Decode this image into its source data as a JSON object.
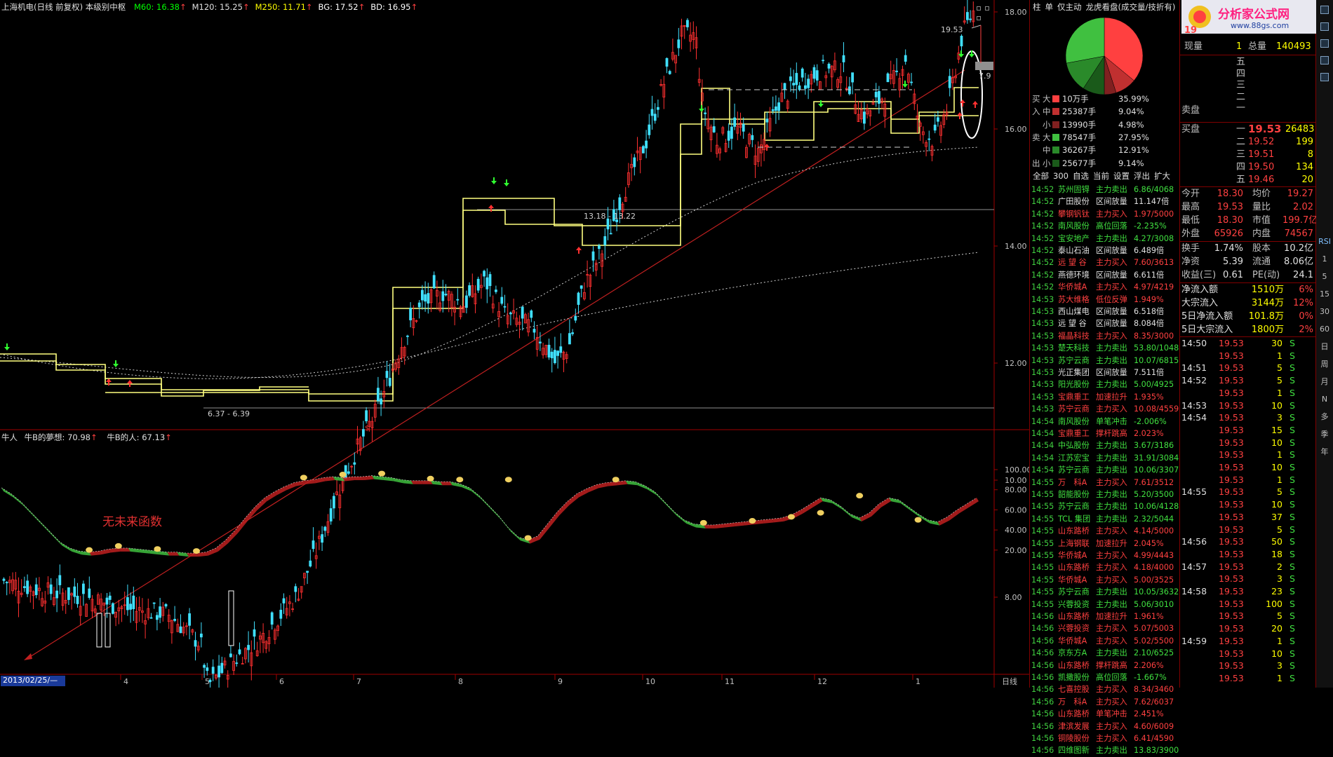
{
  "header": {
    "stock_title": "上海机电(日线 前复权) 本级别中枢",
    "ma_legend": [
      {
        "label": "M60: 16.38",
        "color": "#00ff00"
      },
      {
        "label": "M120: 15.25",
        "color": "#e0e0e0"
      },
      {
        "label": "M250: 11.71",
        "color": "#ffff00"
      },
      {
        "label": "BG: 17.52",
        "color": "#ffffff"
      },
      {
        "label": "BD: 16.95",
        "color": "#ffffff"
      }
    ]
  },
  "main_chart": {
    "y_ticks": [
      "18.00",
      "16.00",
      "14.00",
      "12.00",
      "10.00",
      "8.00"
    ],
    "y_values": [
      18,
      16,
      14,
      12,
      10,
      8
    ],
    "annotations": {
      "high_label": "19.53",
      "range_label": "13.18 - 13.22",
      "low_label": "6.37 - 6.39",
      "right_label": "7.9"
    }
  },
  "indicator": {
    "legend_left": "牛人",
    "legend_a": "牛B的夢想: 70.98",
    "legend_b": "牛B的人: 67.13",
    "note": "无未来函数",
    "y_ticks": [
      "100.00",
      "80.00",
      "60.00",
      "40.00",
      "20.00"
    ],
    "y_values": [
      100,
      80,
      60,
      40,
      20
    ],
    "series_sample": [
      82,
      76,
      68,
      58,
      48,
      38,
      28,
      22,
      19,
      18,
      19,
      21,
      22,
      22,
      21,
      20,
      19,
      18,
      18,
      17,
      17,
      18,
      22,
      30,
      40,
      52,
      63,
      72,
      78,
      83,
      87,
      89,
      90,
      92,
      93,
      92,
      93,
      93,
      94,
      93,
      92,
      90,
      89,
      89,
      89,
      88,
      88,
      86,
      82,
      74,
      64,
      54,
      42,
      33,
      30,
      34,
      46,
      58,
      68,
      76,
      81,
      85,
      87,
      88,
      89,
      88,
      84,
      78,
      68,
      58,
      50,
      46,
      45,
      45,
      46,
      47,
      48,
      49,
      50,
      51,
      52,
      55,
      60,
      66,
      72,
      70,
      64,
      56,
      52,
      57,
      66,
      72,
      70,
      63,
      56,
      50,
      48,
      53,
      60,
      66,
      72
    ]
  },
  "x_axis": {
    "start_date": "2013/02/25/—",
    "labels": [
      "4",
      "5",
      "6",
      "7",
      "8",
      "9",
      "10",
      "11",
      "12",
      "1"
    ],
    "period": "日线"
  },
  "ticker": {
    "tabs": [
      "柱",
      "单",
      "仅主动",
      "龙虎看盘(成交量/技折有)"
    ],
    "pie": [
      {
        "name": "big_sell",
        "value": 35.99,
        "color": "#ff4040"
      },
      {
        "name": "mid_sell",
        "value": 9.04,
        "color": "#c03030"
      },
      {
        "name": "small_sell",
        "value": 4.98,
        "color": "#802020"
      },
      {
        "name": "small_buy",
        "value": 9.14,
        "color": "#1a5a1a"
      },
      {
        "name": "mid_buy",
        "value": 12.91,
        "color": "#2a8a2a"
      },
      {
        "name": "big_buy",
        "value": 27.95,
        "color": "#40c040"
      }
    ],
    "flow": [
      {
        "side": "买",
        "kind": "大",
        "vol": "10万手",
        "pct": "35.99%",
        "color": "#ff4040"
      },
      {
        "side": "入",
        "kind": "中",
        "vol": "25387手",
        "pct": "9.04%",
        "color": "#c03030"
      },
      {
        "side": "",
        "kind": "小",
        "vol": "13990手",
        "pct": "4.98%",
        "color": "#802020"
      },
      {
        "side": "卖",
        "kind": "大",
        "vol": "78547手",
        "pct": "27.95%",
        "color": "#40c040"
      },
      {
        "side": "",
        "kind": "中",
        "vol": "36267手",
        "pct": "12.91%",
        "color": "#2a8a2a"
      },
      {
        "side": "出",
        "kind": "小",
        "vol": "25677手",
        "pct": "9.14%",
        "color": "#1a5a1a"
      }
    ],
    "filters": [
      "全部",
      "300",
      "自选",
      "当前",
      "设置",
      "浮出",
      "扩大"
    ],
    "list": [
      [
        "14:52",
        "苏州固锝",
        "主力卖出",
        "6.86/4068",
        "g"
      ],
      [
        "14:52",
        "广田股份",
        "区间放量",
        "11.147倍",
        "w"
      ],
      [
        "14:52",
        "攀钢钒钛",
        "主力买入",
        "1.97/5000",
        "r"
      ],
      [
        "14:52",
        "南风股份",
        "高位回落",
        "-2.235%",
        "g"
      ],
      [
        "14:52",
        "宝安地产",
        "主力卖出",
        "4.27/3008",
        "g"
      ],
      [
        "14:52",
        "泰山石油",
        "区间放量",
        "6.489倍",
        "w"
      ],
      [
        "14:52",
        "远 望 谷",
        "主力买入",
        "7.60/3613",
        "r"
      ],
      [
        "14:52",
        "燕德环境",
        "区间放量",
        "6.611倍",
        "w"
      ],
      [
        "14:52",
        "华侨城A",
        "主力买入",
        "4.97/4219",
        "r"
      ],
      [
        "14:53",
        "苏大维格",
        "低位反弹",
        "1.949%",
        "r"
      ],
      [
        "14:53",
        "西山煤电",
        "区间放量",
        "6.518倍",
        "w"
      ],
      [
        "14:53",
        "远 望 谷",
        "区间放量",
        "8.084倍",
        "w"
      ],
      [
        "14:53",
        "福晶科技",
        "主力买入",
        "8.35/3000",
        "r"
      ],
      [
        "14:53",
        "楚天科技",
        "主力卖出",
        "53.80/1048",
        "g"
      ],
      [
        "14:53",
        "苏宁云商",
        "主力卖出",
        "10.07/6815",
        "g"
      ],
      [
        "14:53",
        "光正集团",
        "区间放量",
        "7.511倍",
        "w"
      ],
      [
        "14:53",
        "阳光股份",
        "主力卖出",
        "5.00/4925",
        "g"
      ],
      [
        "14:53",
        "宝鼎重工",
        "加速拉升",
        "1.935%",
        "r"
      ],
      [
        "14:53",
        "苏宁云商",
        "主力买入",
        "10.08/4559",
        "r"
      ],
      [
        "14:54",
        "南风股份",
        "单笔冲击",
        "-2.006%",
        "g"
      ],
      [
        "14:54",
        "宝鼎重工",
        "撑杆跳高",
        "2.023%",
        "r"
      ],
      [
        "14:54",
        "中弘股份",
        "主力卖出",
        "3.67/3186",
        "g"
      ],
      [
        "14:54",
        "江苏宏宝",
        "主力卖出",
        "31.91/3084",
        "g"
      ],
      [
        "14:54",
        "苏宁云商",
        "主力卖出",
        "10.06/3307",
        "g"
      ],
      [
        "14:55",
        "万　科A",
        "主力买入",
        "7.61/3512",
        "r"
      ],
      [
        "14:55",
        "韶能股份",
        "主力卖出",
        "5.20/3500",
        "g"
      ],
      [
        "14:55",
        "苏宁云商",
        "主力卖出",
        "10.06/4128",
        "g"
      ],
      [
        "14:55",
        "TCL 集团",
        "主力卖出",
        "2.32/5044",
        "g"
      ],
      [
        "14:55",
        "山东路桥",
        "主力买入",
        "4.14/5000",
        "r"
      ],
      [
        "14:55",
        "上海钢联",
        "加速拉升",
        "2.045%",
        "r"
      ],
      [
        "14:55",
        "华侨城A",
        "主力买入",
        "4.99/4443",
        "r"
      ],
      [
        "14:55",
        "山东路桥",
        "主力买入",
        "4.18/4000",
        "r"
      ],
      [
        "14:55",
        "华侨城A",
        "主力买入",
        "5.00/3525",
        "r"
      ],
      [
        "14:55",
        "苏宁云商",
        "主力卖出",
        "10.05/3632",
        "g"
      ],
      [
        "14:55",
        "兴蓉投资",
        "主力卖出",
        "5.06/3010",
        "g"
      ],
      [
        "14:56",
        "山东路桥",
        "加速拉升",
        "1.961%",
        "r"
      ],
      [
        "14:56",
        "兴蓉投资",
        "主力买入",
        "5.07/5003",
        "r"
      ],
      [
        "14:56",
        "华侨城A",
        "主力买入",
        "5.02/5500",
        "r"
      ],
      [
        "14:56",
        "京东方A",
        "主力卖出",
        "2.10/6525",
        "g"
      ],
      [
        "14:56",
        "山东路桥",
        "撑杆跳高",
        "2.206%",
        "r"
      ],
      [
        "14:56",
        "凯撒股份",
        "高位回落",
        "-1.667%",
        "g"
      ],
      [
        "14:56",
        "七喜控股",
        "主力买入",
        "8.34/3460",
        "r"
      ],
      [
        "14:56",
        "万　科A",
        "主力买入",
        "7.62/6037",
        "r"
      ],
      [
        "14:56",
        "山东路桥",
        "单笔冲击",
        "2.451%",
        "r"
      ],
      [
        "14:56",
        "津滨发展",
        "主力买入",
        "4.60/6009",
        "r"
      ],
      [
        "14:56",
        "铜陵股份",
        "主力买入",
        "6.41/4590",
        "r"
      ],
      [
        "14:56",
        "四维图新",
        "主力卖出",
        "13.83/3900",
        "g"
      ]
    ]
  },
  "quote": {
    "logo_text": "分析家公式网",
    "logo_url": "www.88gs.com",
    "price_big": "19",
    "now_label": "现量",
    "now_val": "1",
    "total_label": "总量",
    "total_val": "140493",
    "sell_levels": [
      "五",
      "四",
      "三",
      "二",
      "一"
    ],
    "sell_label": "卖盘",
    "buy_label": "买盘",
    "buy": [
      {
        "lvl": "一",
        "price": "19.53",
        "vol": "26483"
      },
      {
        "lvl": "二",
        "price": "19.52",
        "vol": "199"
      },
      {
        "lvl": "三",
        "price": "19.51",
        "vol": "8"
      },
      {
        "lvl": "四",
        "price": "19.50",
        "vol": "134"
      },
      {
        "lvl": "五",
        "price": "19.46",
        "vol": "20"
      }
    ],
    "stats": [
      [
        "今开",
        "18.30",
        "均价",
        "19.27"
      ],
      [
        "最高",
        "19.53",
        "量比",
        "2.02"
      ],
      [
        "最低",
        "18.30",
        "市值",
        "199.7亿"
      ],
      [
        "外盘",
        "65926",
        "内盘",
        "74567"
      ]
    ],
    "stats2": [
      [
        "换手",
        "1.74%",
        "股本",
        "10.2亿"
      ],
      [
        "净资",
        "5.39",
        "流通",
        "8.06亿"
      ],
      [
        "收益(三)",
        "0.61",
        "PE(动)",
        "24.1"
      ]
    ],
    "flows": [
      [
        "净流入额",
        "1510万",
        "6%"
      ],
      [
        "大宗流入",
        "3144万",
        "12%"
      ],
      [
        "5日净流入额",
        "101.8万",
        "0%"
      ],
      [
        "5日大宗流入",
        "1800万",
        "2%"
      ]
    ],
    "trades": [
      [
        "14:50",
        "19.53",
        "30",
        "S"
      ],
      [
        "",
        "19.53",
        "1",
        "S"
      ],
      [
        "14:51",
        "19.53",
        "5",
        "S"
      ],
      [
        "14:52",
        "19.53",
        "5",
        "S"
      ],
      [
        "",
        "19.53",
        "1",
        "S"
      ],
      [
        "14:53",
        "19.53",
        "10",
        "S"
      ],
      [
        "14:54",
        "19.53",
        "3",
        "S"
      ],
      [
        "",
        "19.53",
        "15",
        "S"
      ],
      [
        "",
        "19.53",
        "10",
        "S"
      ],
      [
        "",
        "19.53",
        "1",
        "S"
      ],
      [
        "",
        "19.53",
        "10",
        "S"
      ],
      [
        "",
        "19.53",
        "1",
        "S"
      ],
      [
        "14:55",
        "19.53",
        "5",
        "S"
      ],
      [
        "",
        "19.53",
        "10",
        "S"
      ],
      [
        "",
        "19.53",
        "37",
        "S"
      ],
      [
        "",
        "19.53",
        "5",
        "S"
      ],
      [
        "14:56",
        "19.53",
        "50",
        "S"
      ],
      [
        "",
        "19.53",
        "18",
        "S"
      ],
      [
        "14:57",
        "19.53",
        "2",
        "S"
      ],
      [
        "",
        "19.53",
        "3",
        "S"
      ],
      [
        "14:58",
        "19.53",
        "23",
        "S"
      ],
      [
        "",
        "19.53",
        "100",
        "S"
      ],
      [
        "",
        "19.53",
        "5",
        "S"
      ],
      [
        "",
        "19.53",
        "20",
        "S"
      ],
      [
        "14:59",
        "19.53",
        "1",
        "S"
      ],
      [
        "",
        "19.53",
        "10",
        "S"
      ],
      [
        "",
        "19.53",
        "3",
        "S"
      ],
      [
        "",
        "19.53",
        "1",
        "S"
      ]
    ]
  },
  "toolbar": {
    "items": [
      "RSI",
      "1",
      "5",
      "15",
      "30",
      "60",
      "日",
      "周",
      "月",
      "N",
      "多",
      "季",
      "年"
    ]
  }
}
